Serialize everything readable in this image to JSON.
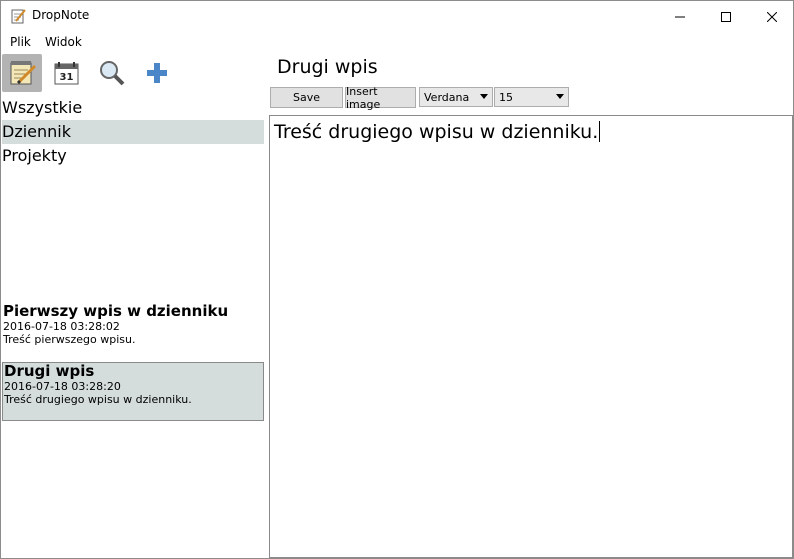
{
  "window": {
    "title": "DropNote"
  },
  "menu": {
    "items": [
      "Plik",
      "Widok"
    ]
  },
  "toolbar": {
    "icons": [
      "notepad-icon",
      "calendar-icon",
      "search-icon",
      "add-icon"
    ],
    "calendar_day": "31"
  },
  "categories": [
    "Wszystkie",
    "Dziennik",
    "Projekty"
  ],
  "selected_category": 1,
  "entries": [
    {
      "title": "Pierwszy wpis w dzienniku",
      "date": "2016-07-18 03:28:02",
      "preview": "Treść pierwszego wpisu."
    },
    {
      "title": "Drugi wpis",
      "date": "2016-07-18 03:28:20",
      "preview": "Treść drugiego wpisu w dzienniku."
    }
  ],
  "selected_entry": 1,
  "editor": {
    "title": "Drugi wpis",
    "save_label": "Save",
    "insert_image_label": "Insert image",
    "font_value": "Verdana",
    "size_value": "15",
    "content": "Treść drugiego wpisu w dzienniku."
  },
  "colors": {
    "selection": "#d4dcdc",
    "toolbar_active": "#b3b3b3",
    "accent_plus": "#4a86c8"
  }
}
